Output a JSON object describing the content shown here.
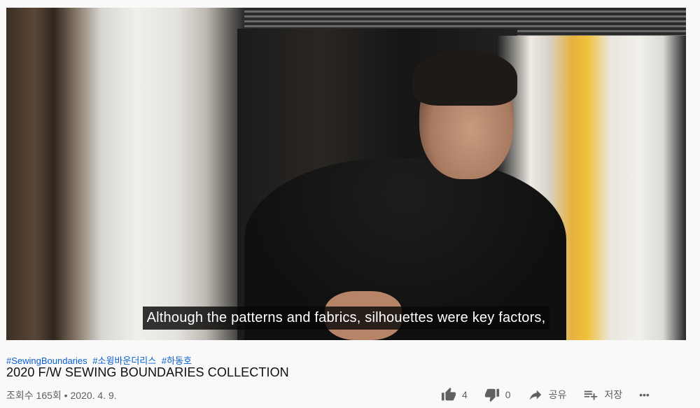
{
  "video": {
    "subtitle": "Although the patterns and fabrics, silhouettes were key factors,"
  },
  "hashtags": [
    "#SewingBoundaries",
    "#소윙바운더리스",
    "#하동호"
  ],
  "title": "2020 F/W SEWING BOUNDARIES COLLECTION",
  "meta": {
    "views": "조회수 165회",
    "separator": "•",
    "date": "2020. 4. 9."
  },
  "actions": {
    "like_count": "4",
    "dislike_count": "0",
    "share_label": "공유",
    "save_label": "저장",
    "more_label": "•••"
  },
  "icons": {
    "like": "thumbs-up-icon",
    "dislike": "thumbs-down-icon",
    "share": "share-arrow-icon",
    "save": "playlist-add-icon",
    "more": "more-horizontal-icon"
  },
  "colors": {
    "hashtag": "#065fd4",
    "meta": "#606060",
    "subtitle_bg": "#080808"
  }
}
